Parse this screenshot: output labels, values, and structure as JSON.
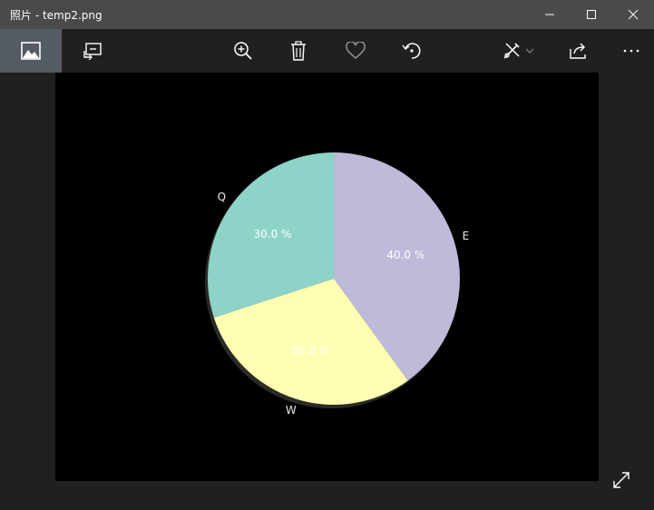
{
  "window": {
    "title": "照片 - temp2.png",
    "controls": [
      "minimize",
      "maximize",
      "close"
    ]
  },
  "toolbar": {
    "left": [
      "image-icon",
      "slideshow-icon"
    ],
    "center": [
      "zoom-in-icon",
      "delete-icon",
      "favorite-heart-icon",
      "rotate-icon"
    ],
    "right": [
      "edit-pen-icon",
      "share-icon",
      "more-icon"
    ]
  },
  "colors": {
    "titlebar": "#4a4a4a",
    "toolbar": "#202020",
    "active_tab": "#545b63",
    "canvas": "#000000"
  },
  "chart_data": {
    "type": "pie",
    "categories": [
      "E",
      "W",
      "Q"
    ],
    "values": [
      40.0,
      30.0,
      30.0
    ],
    "labels": [
      "40.0 %",
      "30.0 %",
      "30.0 %"
    ],
    "colors": [
      "#bebada",
      "#ffffb3",
      "#8dd3c7"
    ],
    "start_angle_deg": 90,
    "direction": "clockwise",
    "shadow": true,
    "title": ""
  }
}
